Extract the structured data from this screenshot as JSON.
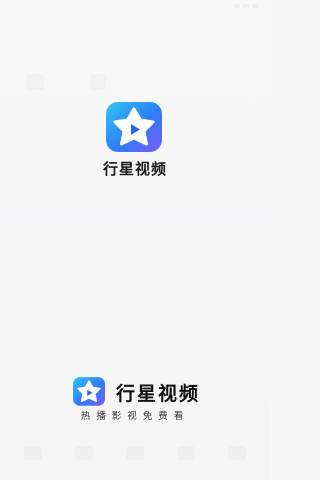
{
  "app": {
    "name": "行星视频",
    "slogan": "热播影视免费看"
  },
  "colors": {
    "accent_blue": "#2f7cf6",
    "accent_cyan": "#2ec9f7",
    "accent_purple": "#7b5cf5",
    "star_white": "#ffffff",
    "play_blue": "#2f64e6"
  },
  "icons": {
    "center_logo": "star-play-logo-icon",
    "bottom_logo": "star-play-logo-icon"
  }
}
